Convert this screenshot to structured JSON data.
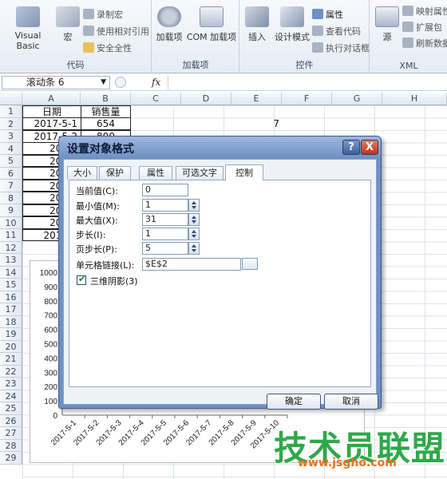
{
  "ribbon": {
    "groups": [
      {
        "label": "代码",
        "big": [
          "Visual Basic",
          "宏"
        ],
        "small": [
          "录制宏",
          "使用相对引用",
          "安全全性"
        ]
      },
      {
        "label": "加载项",
        "big": [
          "加载项",
          "COM 加载项"
        ]
      },
      {
        "label": "控件",
        "big": [
          "插入",
          "设计模式"
        ],
        "small": [
          "属性",
          "查看代码",
          "执行对话框"
        ]
      },
      {
        "label": "XML",
        "big": [
          "源"
        ],
        "small": [
          "映射属性",
          "扩展包",
          "刷新数据"
        ]
      }
    ]
  },
  "formula_bar": {
    "name_box": "滚动条 6",
    "fx": "fx",
    "formula": ""
  },
  "grid": {
    "columns": [
      "A",
      "B",
      "C",
      "D",
      "E",
      "F",
      "G",
      "H"
    ],
    "rows": [
      "1",
      "2",
      "3",
      "4",
      "5",
      "6",
      "7",
      "8",
      "9",
      "10",
      "11",
      "12",
      "13",
      "14",
      "15",
      "16",
      "17",
      "18",
      "19",
      "20",
      "21",
      "22",
      "23",
      "24",
      "25",
      "26",
      "27",
      "28",
      "29"
    ],
    "header_a": "日期",
    "header_b": "销售量",
    "a2": "2017-5-1",
    "b2": "654",
    "a3": "2017-5-2",
    "b3": "800",
    "a_partial": [
      "2017-",
      "2017-",
      "2017-",
      "2017-",
      "2017-",
      "2017-",
      "2017-",
      "2017-5"
    ],
    "e2": "7"
  },
  "chart_data": {
    "type": "line",
    "yticks": [
      "1000",
      "900",
      "800",
      "700",
      "600",
      "500",
      "400",
      "300",
      "200",
      "100",
      "0"
    ],
    "ylim": [
      0,
      1000
    ],
    "categories": [
      "2017-5-1",
      "2017-5-2",
      "2017-5-3",
      "2017-5-4",
      "2017-5-5",
      "2017-5-6",
      "2017-5-7",
      "2017-5-8",
      "2017-5-9",
      "2017-5-10"
    ]
  },
  "dialog": {
    "title": "设置对象格式",
    "help": "?",
    "close": "X",
    "tabs": [
      "大小",
      "保护",
      "属性",
      "可选文字",
      "控制"
    ],
    "active_tab": "控制",
    "fields": {
      "current_label": "当前值(C):",
      "current_value": "0",
      "min_label": "最小值(M):",
      "min_value": "1",
      "max_label": "最大值(X):",
      "max_value": "31",
      "step_label": "步长(I):",
      "step_value": "1",
      "page_label": "页步长(P):",
      "page_value": "5",
      "link_label": "单元格链接(L):",
      "link_value": "$E$2",
      "shading_label": "三维阴影(3)"
    },
    "ok": "确定",
    "cancel": "取消"
  },
  "watermark": {
    "text": "技术员联盟",
    "url": "www.jsgho.com"
  }
}
